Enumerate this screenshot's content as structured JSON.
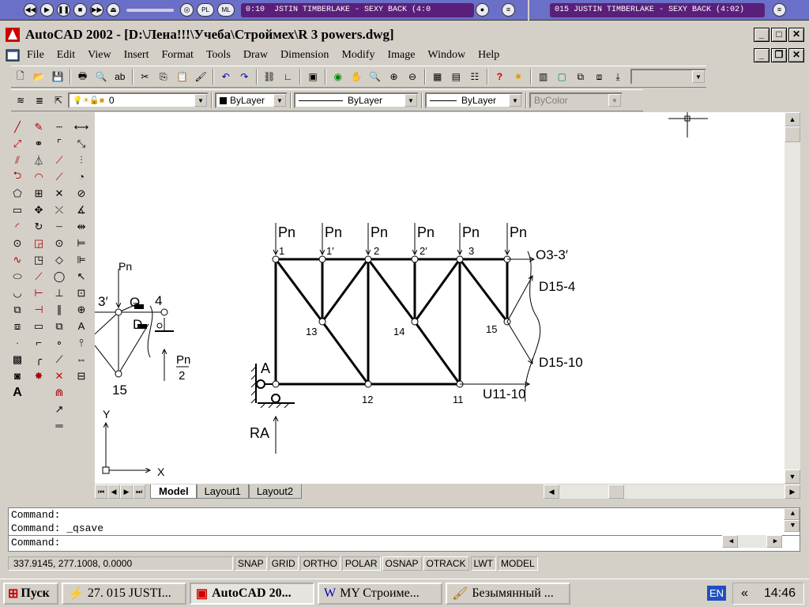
{
  "winamp": {
    "left_time": "0:10",
    "left_title": "JSTIN TIMBERLAKE - SEXY BACK (4:0",
    "right_title": "015 JUSTIN TIMBERLAKE - SEXY BACK (4:02)",
    "pl_label": "PL",
    "ml_label": "ML"
  },
  "window": {
    "title": "AutoCAD 2002 - [D:\\Лена!!!\\Учеба\\Строймех\\R 3 powers.dwg]"
  },
  "menu": [
    "File",
    "Edit",
    "View",
    "Insert",
    "Format",
    "Tools",
    "Draw",
    "Dimension",
    "Modify",
    "Image",
    "Window",
    "Help"
  ],
  "properties": {
    "layer": "0",
    "color": "ByLayer",
    "linetype": "ByLayer",
    "lineweight": "ByLayer",
    "plotstyle": "ByColor"
  },
  "drawing": {
    "loads": [
      "Pn",
      "Pn",
      "Pn",
      "Pn",
      "Pn",
      "Pn"
    ],
    "top_nodes": [
      "1",
      "1′",
      "2",
      "2′",
      "3"
    ],
    "mid_nodes": [
      "13",
      "14",
      "15"
    ],
    "bottom_nodes": [
      "12",
      "11"
    ],
    "support": "A",
    "reaction": "RA",
    "force_o": "O3-3′",
    "force_d1": "D15-4",
    "force_d2": "D15-10",
    "force_u": "U11-10",
    "left_load": "Pn",
    "left_node_a": "3′",
    "left_node_b": "4",
    "left_node_c": "15",
    "left_o": "O",
    "left_d": "D",
    "left_half_top": "Pn",
    "left_half_bottom": "2",
    "axis_y": "Y",
    "axis_x": "X"
  },
  "tabs": [
    "Model",
    "Layout1",
    "Layout2"
  ],
  "command_lines": [
    "Command:",
    "Command: _qsave",
    "Command:"
  ],
  "status": {
    "coords": "337.9145, 277.1008, 0.0000",
    "toggles": [
      "SNAP",
      "GRID",
      "ORTHO",
      "POLAR",
      "OSNAP",
      "OTRACK",
      "LWT",
      "MODEL"
    ]
  },
  "taskbar": {
    "start": "Пуск",
    "tasks": [
      "27. 015 JUSTI...",
      "AutoCAD 20...",
      "MY Строиме...",
      "Безымянный ..."
    ],
    "lang": "EN",
    "tray_arrow": "«",
    "clock": "14:46"
  }
}
